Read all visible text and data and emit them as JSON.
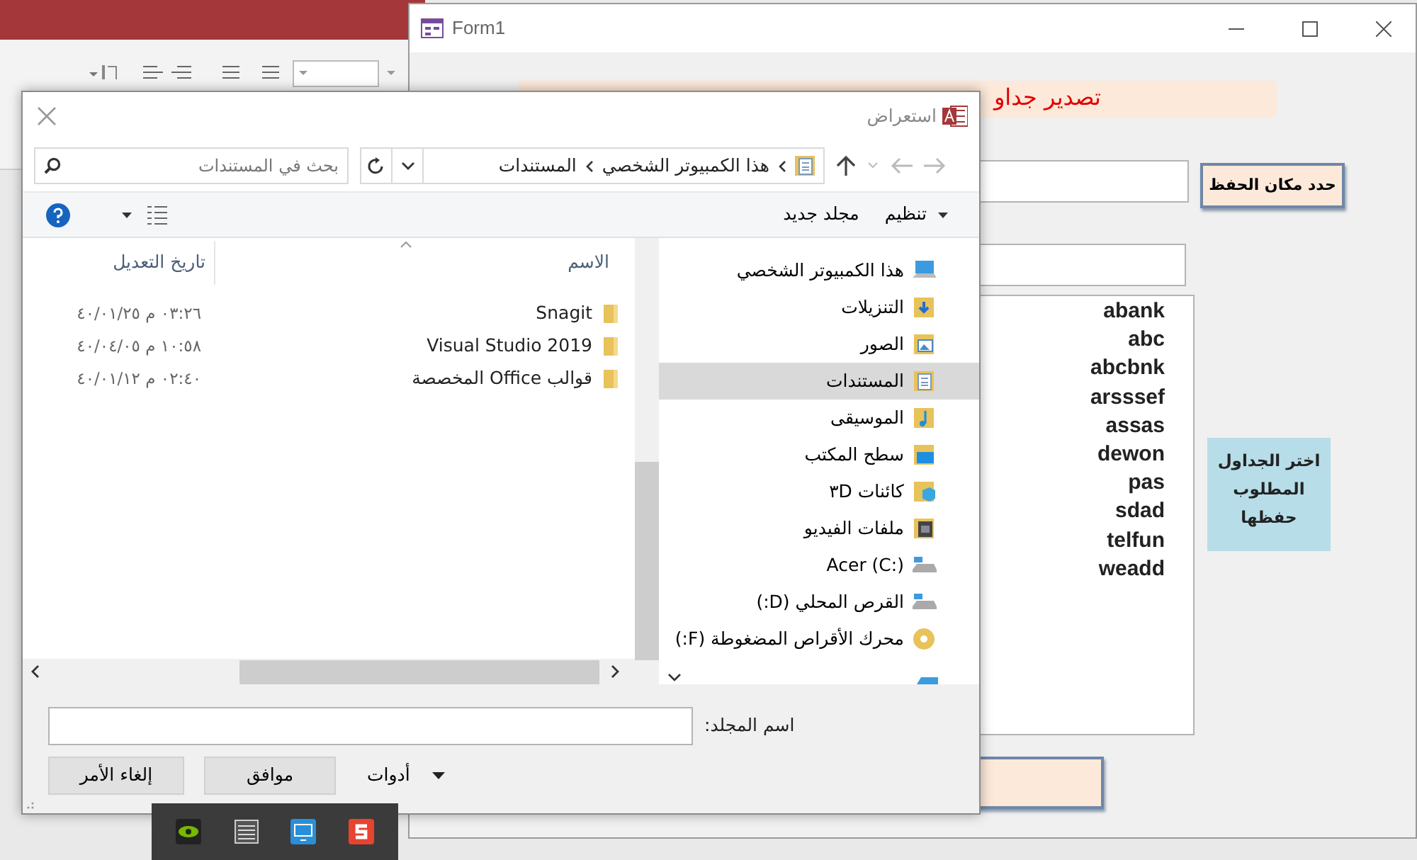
{
  "form_window": {
    "title": "Form1",
    "heading": "تصدير جداو",
    "save_location_button": "حدد مكان الحفظ",
    "tables_label": "اختر الجداول المطلوب حفظها",
    "tables": [
      "abank",
      "abc",
      "abcbnk",
      "arsssef",
      "assas",
      "dewon",
      "pas",
      "sdad",
      "telfun",
      "weadd"
    ]
  },
  "dialog": {
    "title": "استعراض",
    "breadcrumb": [
      "هذا الكمبيوتر الشخصي",
      "المستندات"
    ],
    "search": {
      "placeholder": "بحث في المستندات"
    },
    "toolbar": {
      "organize": "تنظيم",
      "new_folder": "مجلد جديد"
    },
    "columns": [
      {
        "label": "الاسم"
      },
      {
        "label": "تاريخ التعديل"
      }
    ],
    "files": [
      {
        "name": "Snagit",
        "modified": "٤٠/٠١/٢٥ م ٠٣:٢٦"
      },
      {
        "name": "Visual Studio 2019",
        "modified": "٤٠/٠٤/٠٥ م ١٠:٥٨"
      },
      {
        "name": "قوالب Office المخصصة",
        "modified": "٤٠/٠١/١٢ م ٠٢:٤٠"
      }
    ],
    "nav_items": [
      {
        "label": "هذا الكمبيوتر الشخصي",
        "kind": "pc",
        "selected": false
      },
      {
        "label": "التنزيلات",
        "kind": "downloads",
        "selected": false
      },
      {
        "label": "الصور",
        "kind": "pictures",
        "selected": false
      },
      {
        "label": "المستندات",
        "kind": "documents",
        "selected": true
      },
      {
        "label": "الموسيقى",
        "kind": "music",
        "selected": false
      },
      {
        "label": "سطح المكتب",
        "kind": "desktop",
        "selected": false
      },
      {
        "label": "كائنات ٣D",
        "kind": "objects",
        "selected": false
      },
      {
        "label": "ملفات الفيديو",
        "kind": "videos",
        "selected": false
      },
      {
        "label": "Acer (C:)",
        "kind": "drive",
        "selected": false
      },
      {
        "label": "القرص المحلي (D:)",
        "kind": "drive",
        "selected": false
      },
      {
        "label": "محرك الأقراص المضغوطة (F:)",
        "kind": "cdrom",
        "selected": false
      }
    ],
    "folder_label": "اسم المجلد:",
    "tools": "أدوات",
    "ok": "موافق",
    "cancel": "إلغاء الأمر"
  }
}
